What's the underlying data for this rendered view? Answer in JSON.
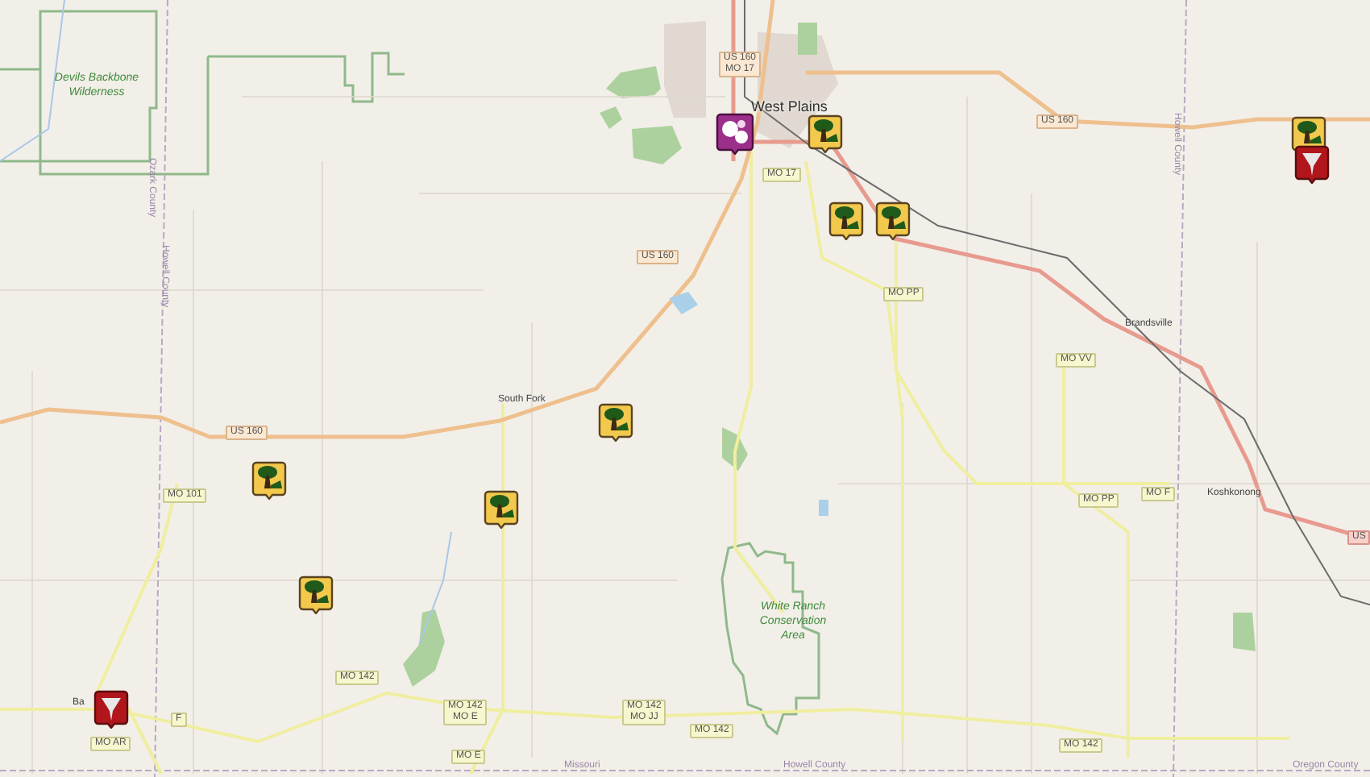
{
  "area_labels": [
    "Devils Backbone Wilderness",
    "White Ranch Conservation Area"
  ],
  "place_labels": [
    {
      "text": "West Plains",
      "kind": "town"
    },
    {
      "text": "South Fork",
      "kind": "village"
    },
    {
      "text": "Brandsville",
      "kind": "village"
    },
    {
      "text": "Koshkonong",
      "kind": "village"
    },
    {
      "text": "Ba",
      "kind": "village"
    }
  ],
  "road_shields": [
    {
      "lines": [
        "US 160",
        "MO 17"
      ],
      "kind": "us"
    },
    {
      "lines": [
        "MO 17"
      ],
      "kind": "state"
    },
    {
      "lines": [
        "US 160"
      ],
      "kind": "us"
    },
    {
      "lines": [
        "MO PP"
      ],
      "kind": "state"
    },
    {
      "lines": [
        "US 160"
      ],
      "kind": "us"
    },
    {
      "lines": [
        "MO VV"
      ],
      "kind": "state"
    },
    {
      "lines": [
        "MO PP"
      ],
      "kind": "state"
    },
    {
      "lines": [
        "MO F"
      ],
      "kind": "state"
    },
    {
      "lines": [
        "US 160"
      ],
      "kind": "us"
    },
    {
      "lines": [
        "MO 101"
      ],
      "kind": "state"
    },
    {
      "lines": [
        "MO 142"
      ],
      "kind": "state"
    },
    {
      "lines": [
        "MO 142",
        "MO E"
      ],
      "kind": "state"
    },
    {
      "lines": [
        "MO 142",
        "MO JJ"
      ],
      "kind": "state"
    },
    {
      "lines": [
        "MO 142"
      ],
      "kind": "state"
    },
    {
      "lines": [
        "MO E"
      ],
      "kind": "state"
    },
    {
      "lines": [
        "MO AR"
      ],
      "kind": "state"
    },
    {
      "lines": [
        "F"
      ],
      "kind": "state"
    },
    {
      "lines": [
        "MO 142"
      ],
      "kind": "state"
    },
    {
      "lines": [
        "US"
      ],
      "kind": "highway"
    }
  ],
  "boundary_labels": [
    {
      "text": "Ozark County",
      "vertical": true
    },
    {
      "text": "Howell County",
      "vertical": true
    },
    {
      "text": "Howell County",
      "vertical": true
    },
    {
      "text": "Missouri",
      "vertical": false
    },
    {
      "text": "Howell County",
      "vertical": false
    },
    {
      "text": "Oregon County",
      "vertical": false
    }
  ],
  "markers": [
    {
      "kind": "cluster"
    },
    {
      "kind": "tree"
    },
    {
      "kind": "tree"
    },
    {
      "kind": "tree"
    },
    {
      "kind": "tree"
    },
    {
      "kind": "tree"
    },
    {
      "kind": "tree"
    },
    {
      "kind": "tree"
    },
    {
      "kind": "tree"
    },
    {
      "kind": "tornado"
    },
    {
      "kind": "tornado"
    }
  ]
}
